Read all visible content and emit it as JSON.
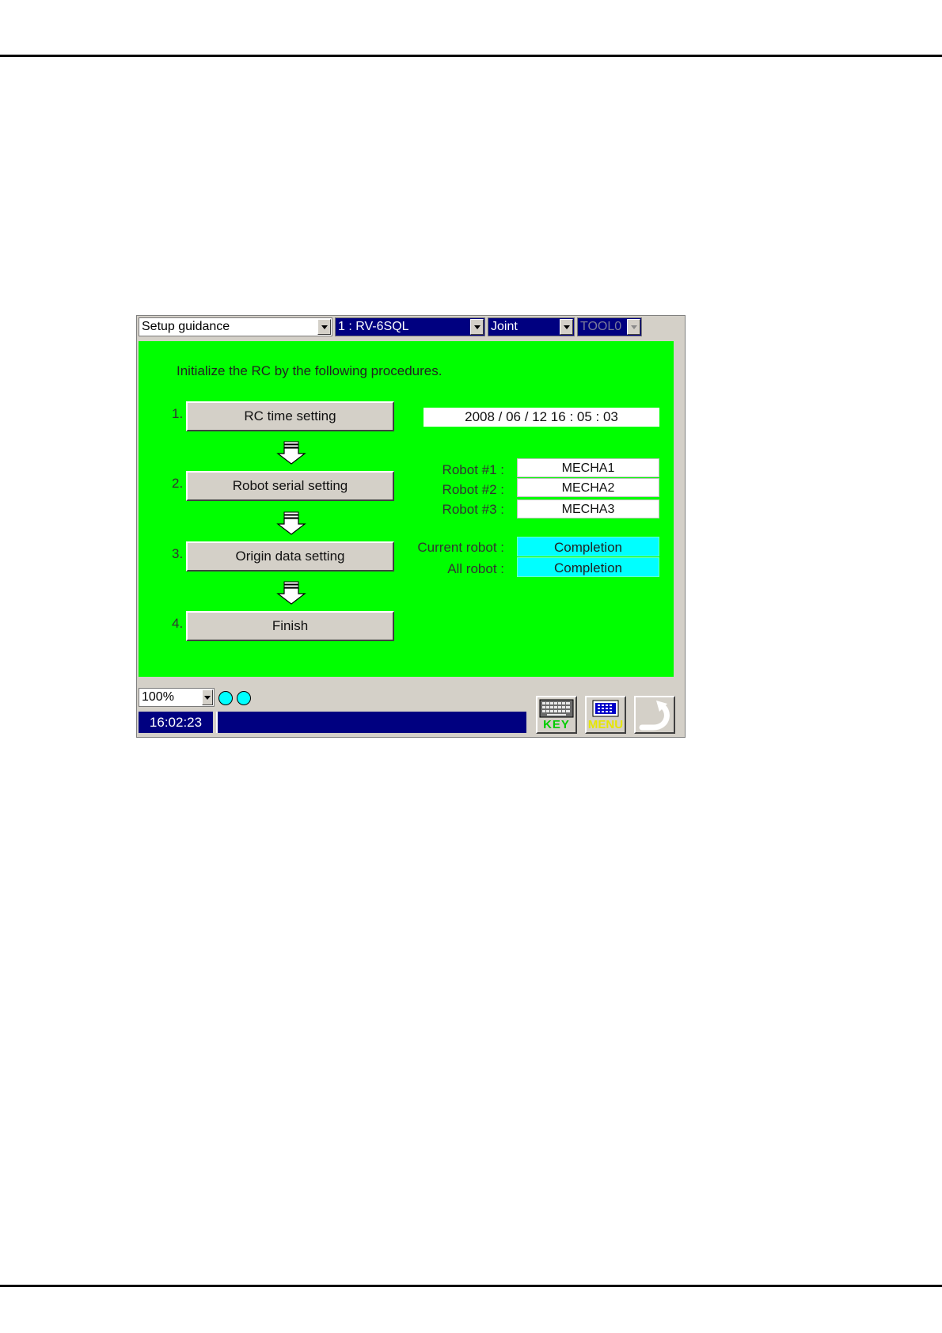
{
  "toolbar": {
    "screen_select": "Setup guidance",
    "robot_select": "1 : RV-6SQL",
    "jog_mode": "Joint",
    "tool": "TOOL0"
  },
  "main": {
    "instruction": "Initialize the RC by the following procedures.",
    "steps": [
      {
        "num": "1.",
        "label": "RC time setting"
      },
      {
        "num": "2.",
        "label": "Robot serial setting"
      },
      {
        "num": "3.",
        "label": "Origin data setting"
      },
      {
        "num": "4.",
        "label": "Finish"
      }
    ],
    "datetime": "2008 / 06 / 12   16 : 05 : 03",
    "robots": [
      {
        "label": "Robot #1 :",
        "value": "MECHA1"
      },
      {
        "label": "Robot #2 :",
        "value": "MECHA2"
      },
      {
        "label": "Robot #3 :",
        "value": "MECHA3"
      }
    ],
    "status": [
      {
        "label": "Current robot :",
        "value": "Completion"
      },
      {
        "label": "All robot :",
        "value": "Completion"
      }
    ]
  },
  "bottom": {
    "override": "100%",
    "clock": "16:02:23",
    "key_label": "KEY",
    "menu_label": "MENU"
  },
  "colors": {
    "background": "#00ff00",
    "status_fill": "#00ffff",
    "header_dark": "#000080"
  }
}
